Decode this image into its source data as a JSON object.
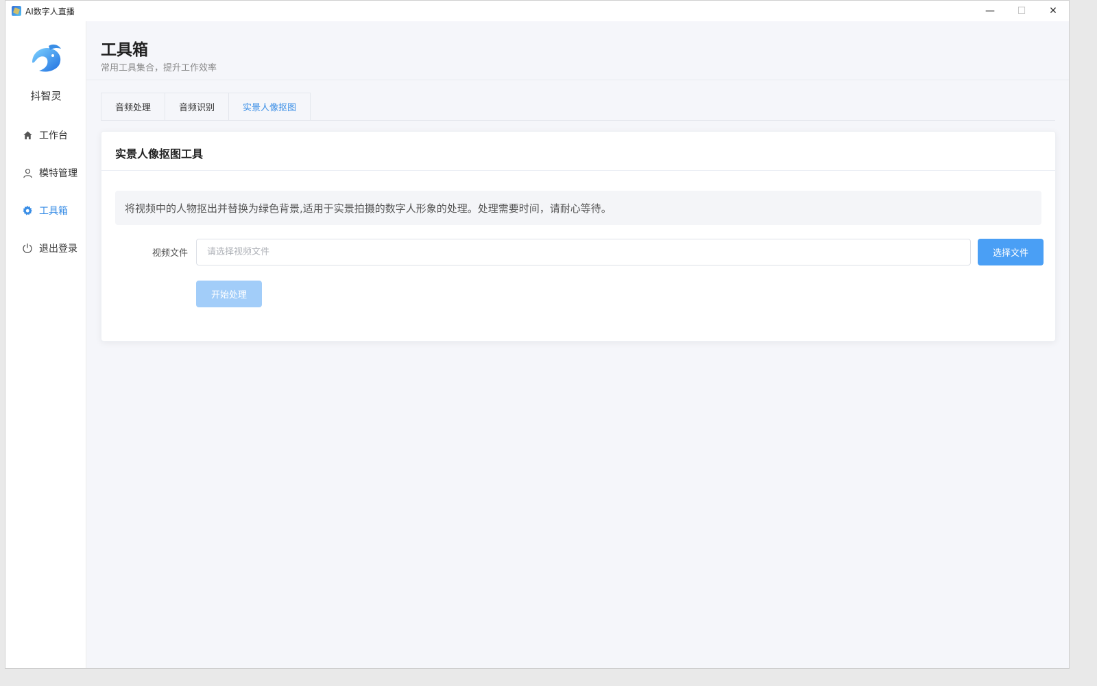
{
  "window": {
    "title": "AI数字人直播",
    "minimize": "—",
    "maximize": "☐",
    "close": "✕"
  },
  "sidebar": {
    "brand": "抖智灵",
    "items": [
      {
        "label": "工作台",
        "icon": "home-icon"
      },
      {
        "label": "模特管理",
        "icon": "user-icon"
      },
      {
        "label": "工具箱",
        "icon": "gear-icon",
        "active": true
      },
      {
        "label": "退出登录",
        "icon": "power-icon"
      }
    ]
  },
  "header": {
    "title": "工具箱",
    "subtitle": "常用工具集合，提升工作效率"
  },
  "tabs": [
    {
      "label": "音频处理"
    },
    {
      "label": "音频识别"
    },
    {
      "label": "实景人像抠图",
      "active": true
    }
  ],
  "card": {
    "title": "实景人像抠图工具",
    "notice": "将视频中的人物抠出并替换为绿色背景,适用于实景拍摄的数字人形象的处理。处理需要时间，请耐心等待。",
    "field_label": "视频文件",
    "file_placeholder": "请选择视频文件",
    "file_value": "",
    "choose_button": "选择文件",
    "start_button": "开始处理"
  },
  "colors": {
    "accent": "#3a8ee6",
    "primary_button": "#4a9ff5",
    "disabled_button": "#a2cdf9"
  }
}
